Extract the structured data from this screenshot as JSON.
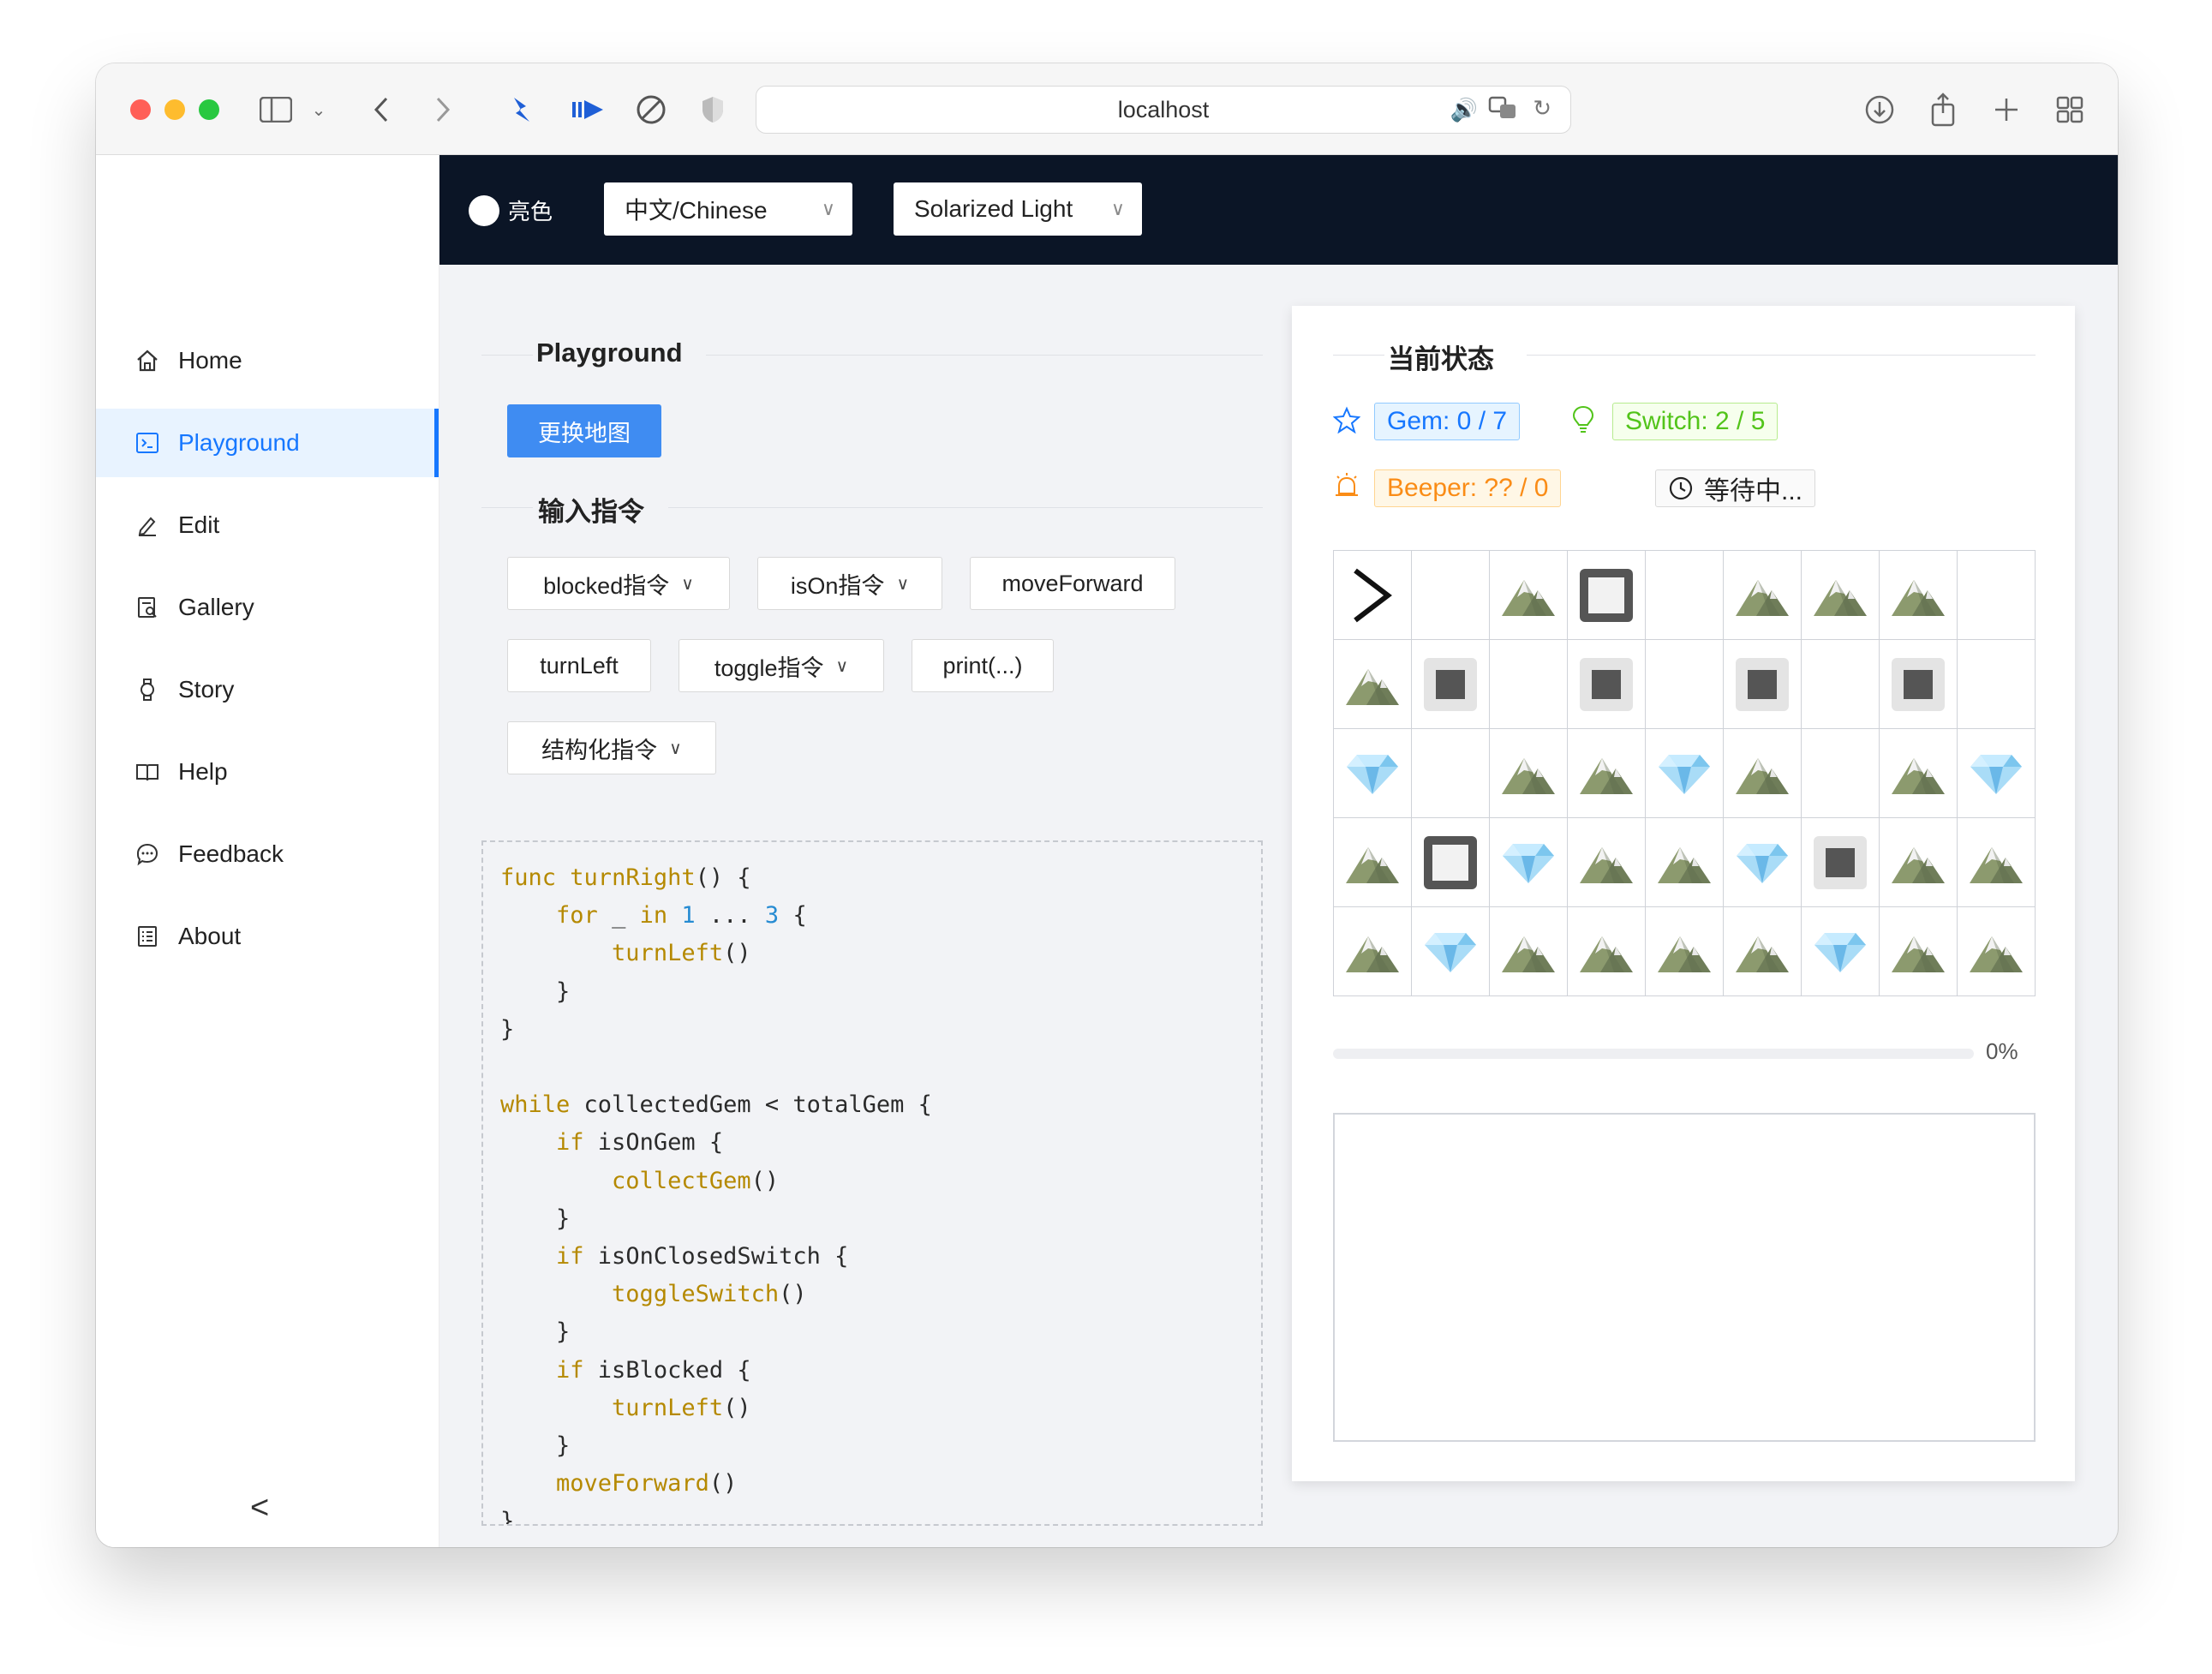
{
  "browser": {
    "url": "localhost"
  },
  "header": {
    "theme_label": "亮色",
    "language": "中文/Chinese",
    "theme": "Solarized Light"
  },
  "sidebar": {
    "items": [
      {
        "label": "Home",
        "icon": "home-icon"
      },
      {
        "label": "Playground",
        "icon": "terminal-icon",
        "active": true
      },
      {
        "label": "Edit",
        "icon": "edit-icon"
      },
      {
        "label": "Gallery",
        "icon": "gallery-icon"
      },
      {
        "label": "Story",
        "icon": "watch-icon"
      },
      {
        "label": "Help",
        "icon": "book-icon"
      },
      {
        "label": "Feedback",
        "icon": "chat-icon"
      },
      {
        "label": "About",
        "icon": "about-icon"
      }
    ],
    "collapse_label": "<"
  },
  "playground": {
    "title": "Playground",
    "change_map_button": "更换地图",
    "commands_title": "输入指令",
    "commands": {
      "blocked": "blocked指令",
      "ison": "isOn指令",
      "move_forward": "moveForward",
      "turn_left": "turnLeft",
      "toggle": "toggle指令",
      "print": "print(...)",
      "structured": "结构化指令"
    },
    "code_lines": [
      "func turnRight() {",
      "    for _ in 1 ... 3 {",
      "        turnLeft()",
      "    }",
      "}",
      "",
      "while collectedGem < totalGem {",
      "    if isOnGem {",
      "        collectGem()",
      "    }",
      "    if isOnClosedSwitch {",
      "        toggleSwitch()",
      "    }",
      "    if isBlocked {",
      "        turnLeft()",
      "    }",
      "    moveForward()",
      "}"
    ]
  },
  "state": {
    "title": "当前状态",
    "gem": "Gem: 0 / 7",
    "switch": "Switch: 2 / 5",
    "beeper": "Beeper: ?? / 0",
    "status": "等待中...",
    "progress": 0,
    "progress_label": "0%",
    "colors": {
      "gem": "#1677ff",
      "switch": "#52c41a",
      "beeper": "#fa8c16"
    },
    "grid": [
      [
        "player",
        "",
        "mountain",
        "switch-open",
        "",
        "mountain",
        "mountain",
        "mountain",
        ""
      ],
      [
        "mountain",
        "switch-closed",
        "",
        "switch-closed",
        "",
        "switch-closed",
        "",
        "switch-closed",
        ""
      ],
      [
        "gem",
        "",
        "mountain",
        "mountain",
        "gem",
        "mountain",
        "",
        "mountain",
        "gem"
      ],
      [
        "mountain",
        "switch-open",
        "gem",
        "mountain",
        "mountain",
        "gem",
        "switch-closed",
        "mountain",
        "mountain"
      ],
      [
        "mountain",
        "gem",
        "mountain",
        "mountain",
        "mountain",
        "mountain",
        "gem",
        "mountain",
        "mountain"
      ]
    ]
  }
}
